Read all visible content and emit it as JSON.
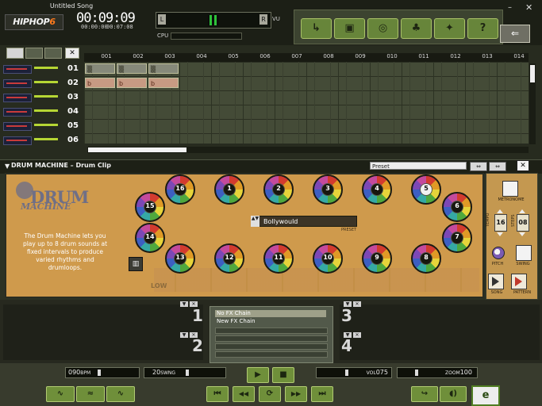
{
  "app": {
    "song_title": "Untitled Song",
    "logo_text": "HIPHOP",
    "logo_version": "6",
    "time_main": "00:09:09",
    "time_secondary_a": "00:00:00",
    "time_secondary_b": "00:07:08",
    "vu_left": "L",
    "vu_right": "R",
    "vu_label": "VU",
    "cpu_label": "CPU",
    "close_glyph": "✕",
    "minimize_glyph": "–",
    "back_glyph": "⇐"
  },
  "toolbar": {
    "tools": [
      {
        "icon": "arrow-import-icon",
        "glyph": "↳"
      },
      {
        "icon": "folder-icon",
        "glyph": "▣"
      },
      {
        "icon": "record-icon",
        "glyph": "◎"
      },
      {
        "icon": "people-icon",
        "glyph": "♣"
      },
      {
        "icon": "mix-icon",
        "glyph": "✦"
      },
      {
        "icon": "help-icon",
        "glyph": "?"
      }
    ]
  },
  "sequencer": {
    "bars": [
      "001",
      "002",
      "003",
      "004",
      "005",
      "006",
      "007",
      "008",
      "009",
      "010",
      "011",
      "012",
      "013",
      "014"
    ],
    "tracks": [
      "01",
      "02",
      "03",
      "04",
      "05",
      "06"
    ],
    "clips": [
      {
        "track": 0,
        "bar": 0,
        "type": "drum",
        "label": "▒"
      },
      {
        "track": 0,
        "bar": 1,
        "type": "drum",
        "label": "▒"
      },
      {
        "track": 0,
        "bar": 2,
        "type": "drum",
        "label": "▒"
      },
      {
        "track": 1,
        "bar": 0,
        "type": "bass",
        "label": "b"
      },
      {
        "track": 1,
        "bar": 1,
        "type": "bass",
        "label": "b"
      },
      {
        "track": 1,
        "bar": 2,
        "type": "bass",
        "label": "b"
      }
    ]
  },
  "drum_machine": {
    "header_title": "DRUM MACHINE – Drum Clip",
    "preset_value": "Preset",
    "logo_text": "DRUM",
    "logo_subtext": "MACHINE",
    "description": "The Drum Machine lets you play up to 8 drum sounds at fixed intervals to produce varied rhythms and drumloops.",
    "kit_name": "Bollywould",
    "kit_arrows": "▲▼",
    "preset_label": "PRESET",
    "low_label": "LOW",
    "pads": [
      {
        "label": "1",
        "on": false
      },
      {
        "label": "2",
        "on": false
      },
      {
        "label": "3",
        "on": false
      },
      {
        "label": "4",
        "on": false
      },
      {
        "label": "5",
        "on": true
      },
      {
        "label": "6",
        "on": false
      },
      {
        "label": "7",
        "on": false
      },
      {
        "label": "8",
        "on": false
      },
      {
        "label": "9",
        "on": false
      },
      {
        "label": "10",
        "on": false
      },
      {
        "label": "11",
        "on": false
      },
      {
        "label": "12",
        "on": false
      },
      {
        "label": "13",
        "on": false
      },
      {
        "label": "14",
        "on": false
      },
      {
        "label": "15",
        "on": false
      },
      {
        "label": "16",
        "on": false
      }
    ],
    "side": {
      "metronome_label": "METRONOME",
      "tempo_label": "TEMPO",
      "tempo_value": "16",
      "steps_label": "STEPS",
      "steps_value": "08",
      "pitch_label": "PITCH",
      "swing_label": "SWING",
      "song_label": "SONG",
      "pattern_label": "PATTERN"
    }
  },
  "fx": {
    "left_numbers": [
      "1",
      "2"
    ],
    "right_numbers": [
      "3",
      "4"
    ],
    "chain_items": [
      "No FX Chain",
      "New FX Chain"
    ]
  },
  "transport": {
    "bpm_value": "090",
    "bpm_unit": "BPM",
    "swing_value": "20",
    "swing_unit": "SWNG",
    "vol_label": "VOL",
    "vol_value": "075",
    "zoom_label": "ZOOM",
    "zoom_value": "100",
    "play_glyph": "▶",
    "stop_glyph": "■",
    "buttons": [
      {
        "icon": "skip-start-icon",
        "glyph": "⏮"
      },
      {
        "icon": "rewind-icon",
        "glyph": "◀◀"
      },
      {
        "icon": "loop-icon",
        "glyph": "⟳"
      },
      {
        "icon": "fast-forward-icon",
        "glyph": "▶▶"
      },
      {
        "icon": "skip-end-icon",
        "glyph": "⏭"
      }
    ]
  },
  "colors": {
    "accent_green": "#6f8f3a",
    "drum_panel": "#cf9a4c",
    "logo_orange": "#ff7b1d"
  }
}
